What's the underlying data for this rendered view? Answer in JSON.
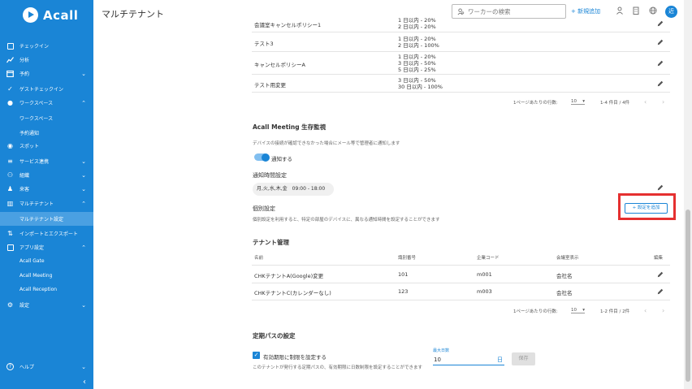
{
  "app": {
    "logo_text": "Acall",
    "page_title": "マルチテナント"
  },
  "header": {
    "search_placeholder": "ワーカーの検索",
    "add_new_label": "+ 新規追加",
    "avatar_text": "近"
  },
  "sidebar": {
    "items": [
      {
        "label": "チェックイン",
        "icon": "checkin-icon"
      },
      {
        "label": "分析",
        "icon": "chart-icon"
      },
      {
        "label": "予約",
        "icon": "calendar-icon",
        "chevron": "down"
      },
      {
        "label": "ゲストチェックイン",
        "icon": "check-icon"
      },
      {
        "label": "ワークスペース",
        "icon": "location-icon",
        "chevron": "up"
      },
      {
        "label": "ワークスペース",
        "sub": true
      },
      {
        "label": "予約通知",
        "sub": true
      },
      {
        "label": "スポット",
        "icon": "pin-icon"
      },
      {
        "label": "サービス連携",
        "icon": "link-icon",
        "chevron": "down"
      },
      {
        "label": "組織",
        "icon": "org-icon",
        "chevron": "down"
      },
      {
        "label": "来客",
        "icon": "guest-icon",
        "chevron": "down"
      },
      {
        "label": "マルチテナント",
        "icon": "building-icon",
        "chevron": "up"
      },
      {
        "label": "マルチテナント設定",
        "sub": true,
        "active": true
      },
      {
        "label": "インポートとエクスポート",
        "icon": "import-export-icon"
      },
      {
        "label": "アプリ設定",
        "icon": "app-icon",
        "chevron": "up"
      },
      {
        "label": "Acall Gate",
        "sub": true
      },
      {
        "label": "Acall Meeting",
        "sub": true
      },
      {
        "label": "Acall Reception",
        "sub": true
      },
      {
        "label": "設定",
        "icon": "gear-icon",
        "chevron": "down"
      }
    ],
    "help_label": "ヘルプ",
    "collapse_label": "‹"
  },
  "policy_table": {
    "rows": [
      {
        "name": "会議室キャンセルポリシー1",
        "rules": [
          "1 日以内 - 20%",
          "2 日以内 - 20%"
        ]
      },
      {
        "name": "テスト3",
        "rules": [
          "1 日以内 - 20%",
          "2 日以内 - 100%"
        ]
      },
      {
        "name": "キャンセルポリシーA",
        "rules": [
          "1 日以内 - 20%",
          "3 日以内 - 50%",
          "5 日以内 - 25%"
        ]
      },
      {
        "name": "テスト用変更",
        "rules": [
          "3 日以内 - 50%",
          "30 日以内 - 100%"
        ]
      }
    ],
    "pager": {
      "per_page_label": "1ページあたりの行数:",
      "per_page": "10",
      "range": "1-4 件目 / 4件"
    }
  },
  "meeting_monitor": {
    "title": "Acall Meeting 生存監視",
    "description": "デバイスの接続が確認できなかった場合にメール等で管理者に通知します",
    "toggle_label": "通知する",
    "notify_time_title": "通知時間設定",
    "schedule": "月,火,水,木,金　09:00 - 18:00",
    "individual_title": "個別設定",
    "individual_desc": "個別設定を利用すると、特定の部屋のデバイスに、異なる通知時間を設定することができます",
    "add_setting_label": "+ 設定を追加"
  },
  "tenant_mgmt": {
    "title": "テナント管理",
    "columns": [
      "名前",
      "識別番号",
      "企業コード",
      "会議室表示",
      "編集"
    ],
    "rows": [
      {
        "name": "CHKテナントA(Google)変更",
        "id": "101",
        "code": "m001",
        "display": "会社名"
      },
      {
        "name": "CHKテナントC(カレンダーなし)",
        "id": "123",
        "code": "m003",
        "display": "会社名"
      }
    ],
    "pager": {
      "per_page_label": "1ページあたりの行数:",
      "per_page": "10",
      "range": "1-2 件目 / 2件"
    }
  },
  "pass_settings": {
    "title": "定期パスの設定",
    "checkbox_label": "有効期限に制限を設定する",
    "checkbox_desc": "このテナントが発行する定期パスの、有効期限に日数制限を設定することができます",
    "max_days_label": "最大日数",
    "max_days_value": "10",
    "unit": "日",
    "save_label": "保存"
  }
}
